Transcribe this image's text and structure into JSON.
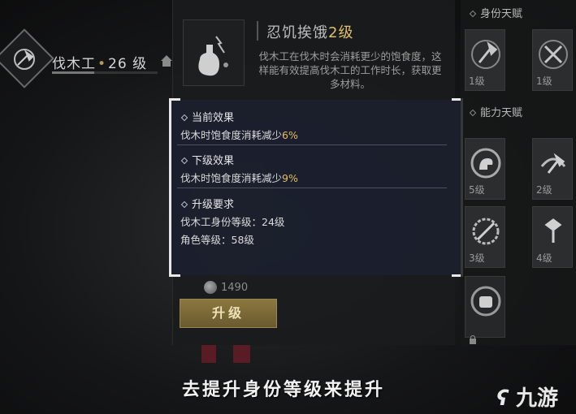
{
  "identity": {
    "name": "伐木工",
    "separator": "•",
    "level": "26 级"
  },
  "skill": {
    "title_prefix": "忍饥挨饿",
    "title_level": "2级",
    "description": "伐木工在伐木时会消耗更少的饱食度，这样能有效提高伐木工的工作时长，获取更多材料。"
  },
  "tooltip": {
    "current": {
      "header": "当前效果",
      "text": "伐木时饱食度消耗减少",
      "value": "6%"
    },
    "next": {
      "header": "下级效果",
      "text": "伐木时饱食度消耗减少",
      "value": "9%"
    },
    "requirements": {
      "header": "升级要求",
      "lines": [
        "伐木工身份等级：24级",
        "角色等级：58级"
      ]
    }
  },
  "cost": {
    "value": "1490"
  },
  "upgrade_button": {
    "label": "升级"
  },
  "right_panel": {
    "identity_talents": {
      "header": "身份天赋",
      "tiles": [
        {
          "level": "1级",
          "icon": "axe-icon"
        },
        {
          "level": "1级",
          "icon": "axe-crossed-icon"
        }
      ]
    },
    "ability_talents": {
      "header": "能力天赋",
      "tiles": [
        {
          "level": "5级",
          "icon": "arm-strength-icon"
        },
        {
          "level": "2级",
          "icon": "axe-swing-icon"
        },
        {
          "level": "3级",
          "icon": "sawblade-icon"
        },
        {
          "level": "4级",
          "icon": "axe-upgrade-icon"
        },
        {
          "level": "",
          "icon": "fist-icon"
        }
      ]
    }
  },
  "subtitle": "去提升身份等级来提升",
  "watermark": "九游",
  "colors": {
    "highlight": "#e3bd63",
    "tooltip_bg": "#1c202d",
    "button": "#8c7840"
  }
}
